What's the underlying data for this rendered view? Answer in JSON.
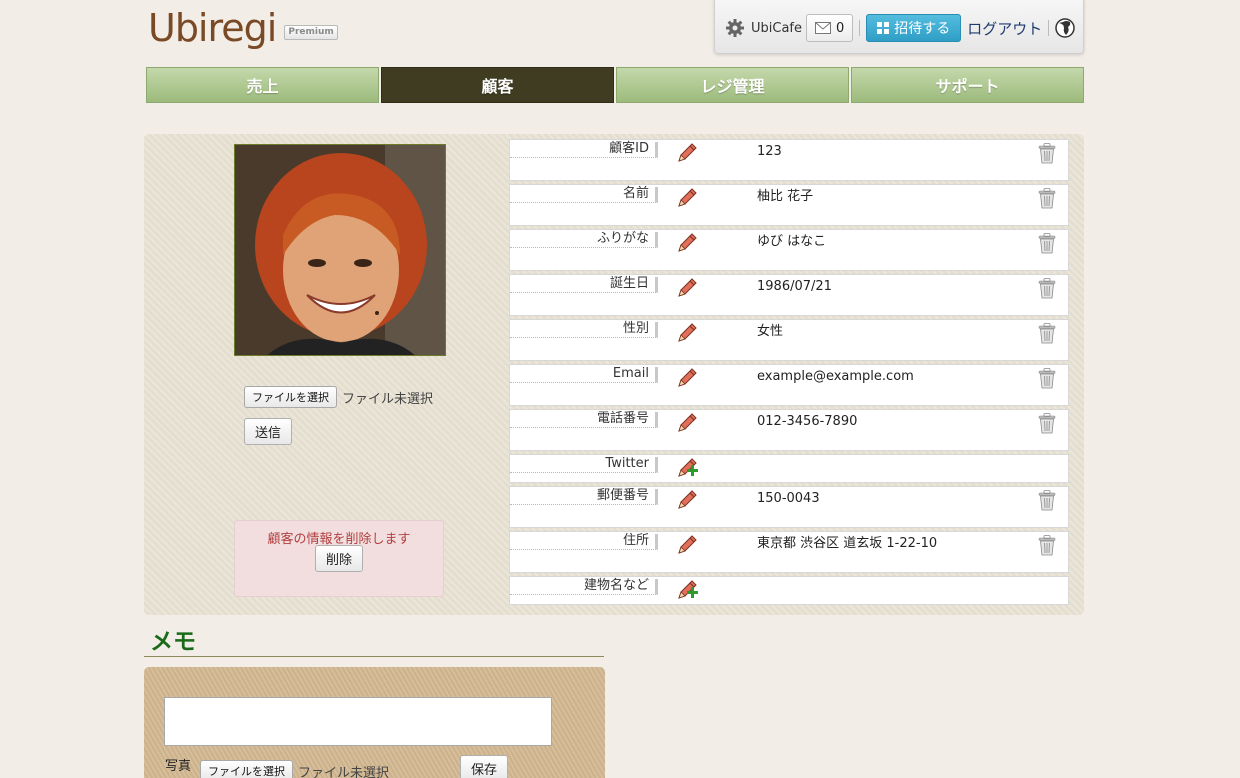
{
  "header": {
    "logo": "Ubiregi",
    "badge": "Premium",
    "account": {
      "shop_name": "UbiCafe",
      "message_count": "0",
      "invite_label": "招待する",
      "logout_label": "ログアウト"
    }
  },
  "nav": {
    "tabs": [
      {
        "label": "売上"
      },
      {
        "label": "顧客"
      },
      {
        "label": "レジ管理"
      },
      {
        "label": "サポート"
      }
    ],
    "active": "顧客"
  },
  "photo_panel": {
    "file_button": "ファイルを選択",
    "file_status": "ファイル未選択",
    "submit_label": "送信",
    "delete_message": "顧客の情報を削除します",
    "delete_label": "削除"
  },
  "fields": [
    {
      "label": "顧客ID",
      "value": "123",
      "action": "edit"
    },
    {
      "label": "名前",
      "value": "柚比 花子",
      "action": "edit"
    },
    {
      "label": "ふりがな",
      "value": "ゆび はなこ",
      "action": "edit"
    },
    {
      "label": "誕生日",
      "value": "1986/07/21",
      "action": "edit"
    },
    {
      "label": "性別",
      "value": "女性",
      "action": "edit"
    },
    {
      "label": "Email",
      "value": "example@example.com",
      "action": "edit"
    },
    {
      "label": "電話番号",
      "value": "012-3456-7890",
      "action": "edit"
    },
    {
      "label": "Twitter",
      "value": "",
      "action": "add"
    },
    {
      "label": "郵便番号",
      "value": "150-0043",
      "action": "edit"
    },
    {
      "label": "住所",
      "value": "東京都 渋谷区 道玄坂 1-22-10",
      "action": "edit"
    },
    {
      "label": "建物名など",
      "value": "",
      "action": "add"
    }
  ],
  "memo": {
    "title": "メモ",
    "text": "",
    "photo_label": "写真",
    "file_button": "ファイルを選択",
    "file_status": "ファイル未選択",
    "save_label": "保存"
  },
  "colors": {
    "nav_green": "#9dbb7c",
    "nav_active": "#3f3c22",
    "invite_blue": "#2f9ec6",
    "delete_pink": "#f2dede",
    "memo_title_green": "#1a6a1a"
  }
}
